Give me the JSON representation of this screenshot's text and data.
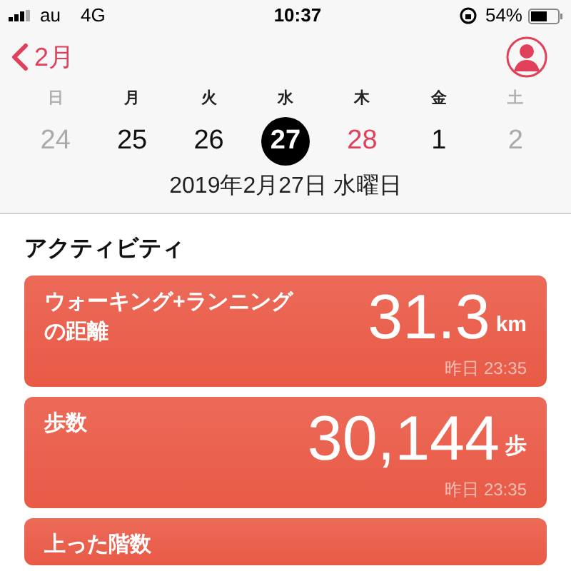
{
  "status_bar": {
    "carrier": "au",
    "network": "4G",
    "time": "10:37",
    "battery_percent": "54%"
  },
  "nav": {
    "back_label": "2月"
  },
  "weekdays": [
    {
      "label": "日",
      "weekend": true
    },
    {
      "label": "月",
      "weekend": false
    },
    {
      "label": "火",
      "weekend": false
    },
    {
      "label": "水",
      "weekend": false
    },
    {
      "label": "木",
      "weekend": false
    },
    {
      "label": "金",
      "weekend": false
    },
    {
      "label": "土",
      "weekend": true
    }
  ],
  "days": [
    {
      "label": "24",
      "selected": false,
      "today": false,
      "dimmed": true
    },
    {
      "label": "25",
      "selected": false,
      "today": false,
      "dimmed": false
    },
    {
      "label": "26",
      "selected": false,
      "today": false,
      "dimmed": false
    },
    {
      "label": "27",
      "selected": true,
      "today": false,
      "dimmed": false
    },
    {
      "label": "28",
      "selected": false,
      "today": true,
      "dimmed": false
    },
    {
      "label": "1",
      "selected": false,
      "today": false,
      "dimmed": false
    },
    {
      "label": "2",
      "selected": false,
      "today": false,
      "dimmed": true
    }
  ],
  "selected_date": "2019年2月27日 水曜日",
  "section_title": "アクティビティ",
  "cards": [
    {
      "title": "ウォーキング+ランニングの距離",
      "value": "31.3",
      "unit": "km",
      "time": "昨日 23:35"
    },
    {
      "title": "歩数",
      "value": "30,144",
      "unit": "歩",
      "time": "昨日 23:35"
    },
    {
      "title": "上った階数"
    }
  ]
}
